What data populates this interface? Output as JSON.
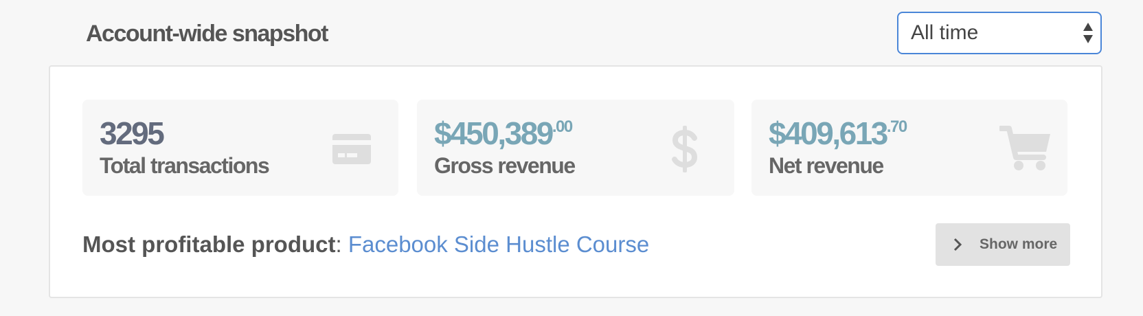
{
  "header": {
    "title": "Account-wide snapshot"
  },
  "period_select": {
    "value": "All time"
  },
  "stats": [
    {
      "value": "3295",
      "cents": "",
      "label": "Total transactions",
      "icon": "credit-card-icon"
    },
    {
      "value": "$450,389",
      "cents": ".00",
      "label": "Gross revenue",
      "icon": "dollar-icon"
    },
    {
      "value": "$409,613",
      "cents": ".70",
      "label": "Net revenue",
      "icon": "shopping-cart-icon"
    }
  ],
  "footer": {
    "label": "Most profitable product",
    "separator": ":",
    "product": "Facebook Side Hustle Course",
    "show_more": "Show more"
  },
  "colors": {
    "accent_blue": "#4a86d8",
    "link_blue": "#5b8dd0",
    "value_dark": "#636b7d",
    "value_teal": "#79a6b6",
    "icon_gray": "#dedede"
  }
}
